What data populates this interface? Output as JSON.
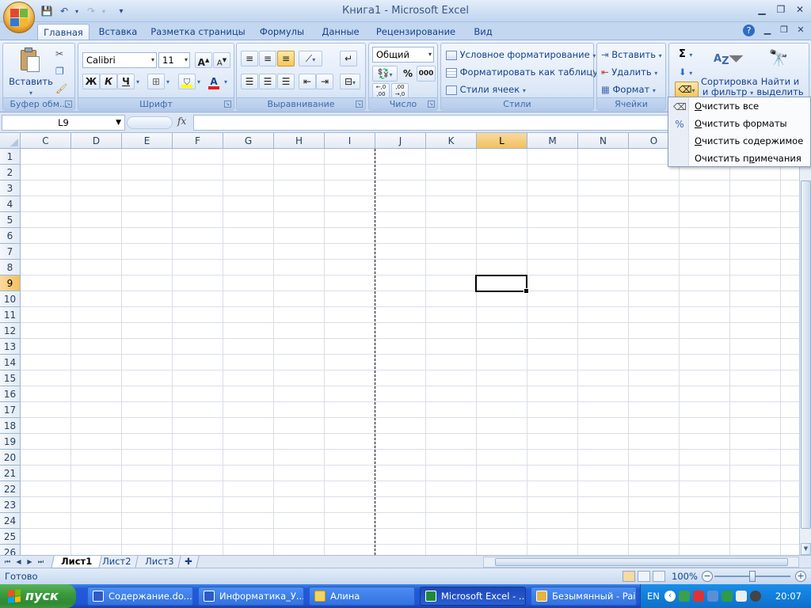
{
  "window": {
    "title": "Книга1  -  Microsoft Excel",
    "minimize": "▁",
    "maximize": "❐",
    "close": "✕"
  },
  "qat": {
    "save": "💾",
    "undo": "↶",
    "redo": "↷",
    "more": "▾"
  },
  "tabs": [
    "Главная",
    "Вставка",
    "Разметка страницы",
    "Формулы",
    "Данные",
    "Рецензирование",
    "Вид"
  ],
  "ribbon": {
    "clipboard": {
      "label": "Буфер обм...",
      "paste": "Вставить"
    },
    "font": {
      "label": "Шрифт",
      "name": "Calibri",
      "size": "11",
      "bold": "Ж",
      "italic": "К",
      "underline": "Ч",
      "grow": "A",
      "shrink": "A",
      "color_letter": "A"
    },
    "alignment": {
      "label": "Выравнивание"
    },
    "number": {
      "label": "Число",
      "format": "Общий",
      "percent": "%",
      "thousands": "000",
      "inc_dec": ",0→,00",
      "dec_dec": ",00→,0"
    },
    "styles": {
      "label": "Стили",
      "conditional": "Условное форматирование",
      "as_table": "Форматировать как таблицу",
      "cell_styles": "Стили ячеек"
    },
    "cells": {
      "label": "Ячейки",
      "insert": "Вставить",
      "delete": "Удалить",
      "format": "Формат"
    },
    "editing": {
      "sum": "Σ",
      "sort_line1": "Сортировка",
      "sort_line2": "и фильтр",
      "find_line1": "Найти и",
      "find_line2": "выделить"
    }
  },
  "formula_bar": {
    "name_box": "L9",
    "fx": "fx",
    "value": ""
  },
  "columns": [
    "C",
    "D",
    "E",
    "F",
    "G",
    "H",
    "I",
    "J",
    "K",
    "L",
    "M",
    "N",
    "O"
  ],
  "rows": [
    "1",
    "2",
    "3",
    "4",
    "5",
    "6",
    "7",
    "8",
    "9",
    "10",
    "11",
    "12",
    "13",
    "14",
    "15",
    "16",
    "17",
    "18",
    "19",
    "20",
    "21",
    "22",
    "23",
    "24",
    "25",
    "26"
  ],
  "selected": {
    "column": "L",
    "row": "9"
  },
  "sheets": {
    "tabs": [
      "Лист1",
      "Лист2",
      "Лист3"
    ],
    "active": "Лист1"
  },
  "status": {
    "text": "Готово",
    "zoom": "100%"
  },
  "clear_menu": {
    "items": [
      {
        "prefix": "",
        "underlined": "О",
        "rest": "чистить все"
      },
      {
        "prefix": "",
        "underlined": "О",
        "rest": "чистить форматы"
      },
      {
        "prefix": "",
        "underlined": "О",
        "rest": "чистить содержимое"
      },
      {
        "prefix": "Очистить п",
        "underlined": "р",
        "rest": "имечания"
      }
    ]
  },
  "taskbar": {
    "start": "пуск",
    "items": [
      "Содержание.do...",
      "Информатика_У...",
      "Алина",
      "Microsoft Excel - ...",
      "Безымянный - Paint"
    ],
    "active": "Microsoft Excel - ...",
    "lang": "EN",
    "clock": "20:07"
  },
  "colors": {
    "accent": "#15428b",
    "selection": "#f1c15f",
    "taskbar": "#2459d8",
    "start": "#3c9a3f"
  }
}
